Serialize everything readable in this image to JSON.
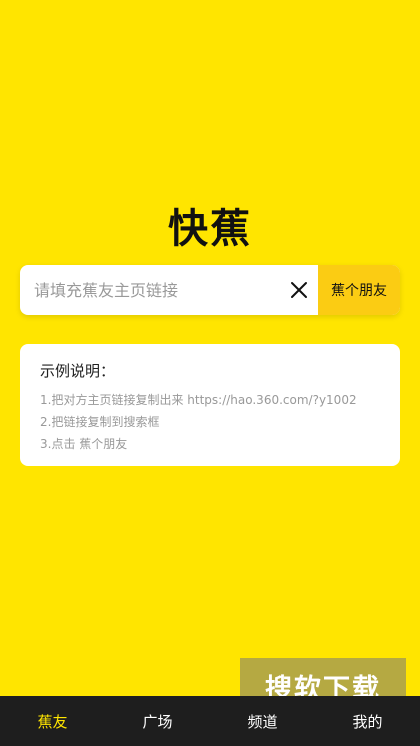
{
  "app": {
    "logo_text": "快蕉"
  },
  "search": {
    "placeholder": "请填充蕉友主页链接",
    "value": "",
    "button_label": "蕉个朋友"
  },
  "example": {
    "title": "示例说明：",
    "steps": [
      "1.把对方主页链接复制出来 https://hao.360.com/?y1002",
      "2.把链接复制到搜索框",
      "3.点击 蕉个朋友"
    ]
  },
  "watermark": {
    "text": "搜软下载"
  },
  "bottom_nav": {
    "active_index": 0,
    "tabs": [
      {
        "label": "蕉友"
      },
      {
        "label": "广场"
      },
      {
        "label": "频道"
      },
      {
        "label": "我的"
      }
    ]
  },
  "colors": {
    "background": "#ffe500",
    "button": "#fbcc13",
    "nav_bg": "#1e1e1e",
    "nav_active": "#ffe500"
  }
}
